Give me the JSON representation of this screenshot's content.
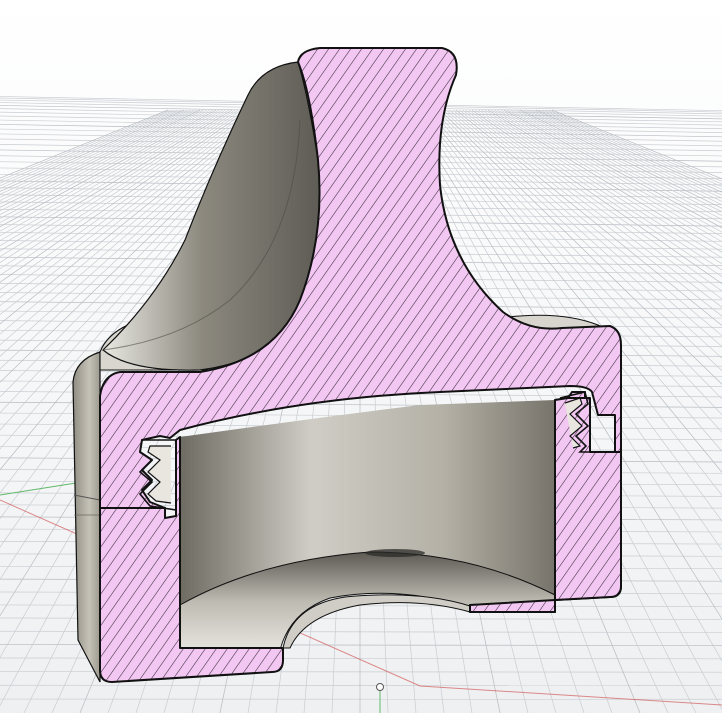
{
  "viewport": {
    "name": "3D section view",
    "background_top": "#ffffff",
    "background_bottom": "#eef0f2",
    "grid_color": "#c9cdd2",
    "grid_major_color": "#b7bcc2"
  },
  "axes": {
    "x_axis_color": "#d35a5a",
    "y_axis_color": "#63b86a"
  },
  "part": {
    "body_color": "#b7b3a6",
    "body_shadow": "#7e7b70",
    "body_highlight": "#e3e1da",
    "section_fill": "#f2c7f2",
    "section_hatch": "#3a2a3a",
    "outline": "#111111"
  },
  "origin": {
    "icon": "origin-marker-icon"
  }
}
